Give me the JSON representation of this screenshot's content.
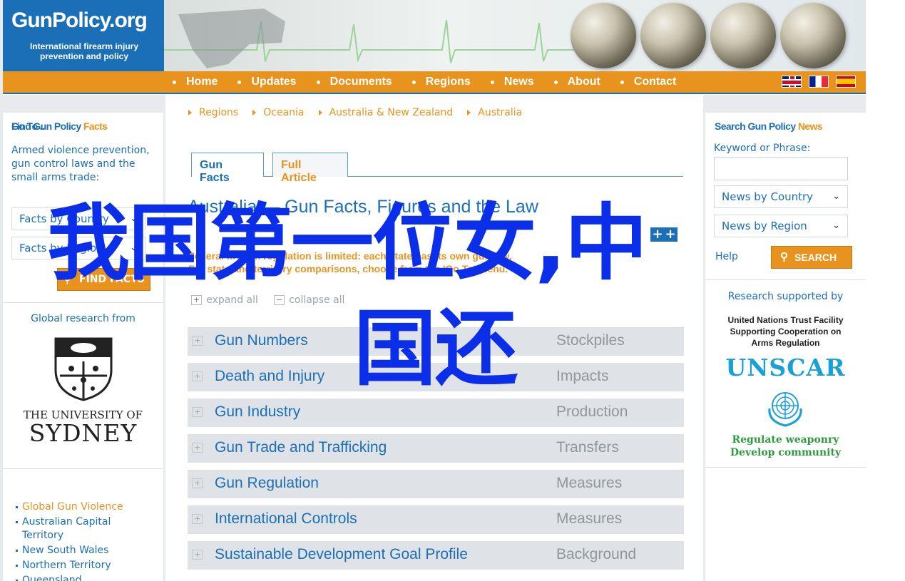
{
  "header": {
    "logo_title": "GunPolicy.org",
    "logo_subtitle": "International firearm injury prevention and policy"
  },
  "nav": {
    "items": [
      {
        "label": "Home"
      },
      {
        "label": "Updates"
      },
      {
        "label": "Documents"
      },
      {
        "label": "Regions"
      },
      {
        "label": "News"
      },
      {
        "label": "About"
      },
      {
        "label": "Contact"
      }
    ],
    "flags": [
      "uk-flag-icon",
      "france-flag-icon",
      "spain-flag-icon"
    ]
  },
  "left": {
    "heading_main": "Find Gun Policy ",
    "heading_accent": "Facts",
    "description": "Armed violence prevention, gun control laws and the small arms trade:",
    "select_country": "Facts by Country",
    "select_region": "Facts by Region",
    "find_button": "FIND FACTS",
    "research_from": "Global research from",
    "university_line1": "THE UNIVERSITY OF",
    "university_line2": "SYDNEY",
    "goto_heading": "Go To ..",
    "goto_items": [
      "Global Gun Violence",
      "Australian Capital Territory",
      "New South Wales",
      "Northern Territory",
      "Queensland"
    ]
  },
  "main": {
    "breadcrumbs": [
      "Regions",
      "Oceania",
      "Australia & New Zealand",
      "Australia"
    ],
    "tabs": [
      "Gun Facts",
      "Full Article"
    ],
    "title": "Australia — Gun Facts, Figures and the Law",
    "notice_line1": "Federal firearm regulation is limited: each state has its own gun law.",
    "notice_line2": "For state and territory comparisons, choose from the 'Go To' menu.",
    "expand_all": "expand all",
    "collapse_all": "collapse all",
    "rows": [
      {
        "label": "Gun Numbers",
        "side": "Stockpiles"
      },
      {
        "label": "Death and Injury",
        "side": "Impacts"
      },
      {
        "label": "Gun Industry",
        "side": "Production"
      },
      {
        "label": "Gun Trade and Trafficking",
        "side": "Transfers"
      },
      {
        "label": "Gun Regulation",
        "side": "Measures"
      },
      {
        "label": "International Controls",
        "side": "Measures"
      },
      {
        "label": "Sustainable Development Goal Profile",
        "side": "Background"
      }
    ]
  },
  "right": {
    "heading_main": "Search Gun Policy ",
    "heading_accent": "News",
    "keyword_label": "Keyword or Phrase:",
    "keyword_value": "",
    "select_country": "News by Country",
    "select_region": "News by Region",
    "help": "Help",
    "search_button": "SEARCH",
    "supported": "Research supported by",
    "untf_line1": "United Nations Trust Facility",
    "untf_line2": "Supporting Cooperation on",
    "untf_line3": "Arms Regulation",
    "unscar": "UNSCAR",
    "slogan_line1": "Regulate weaponry",
    "slogan_line2": "Develop community"
  },
  "overlay": {
    "line1": "我国第一位女,中",
    "line2": "国还"
  },
  "colors": {
    "brand_blue": "#1b6fb7",
    "brand_orange": "#e8931e",
    "overlay_blue": "#0b2ee8"
  }
}
